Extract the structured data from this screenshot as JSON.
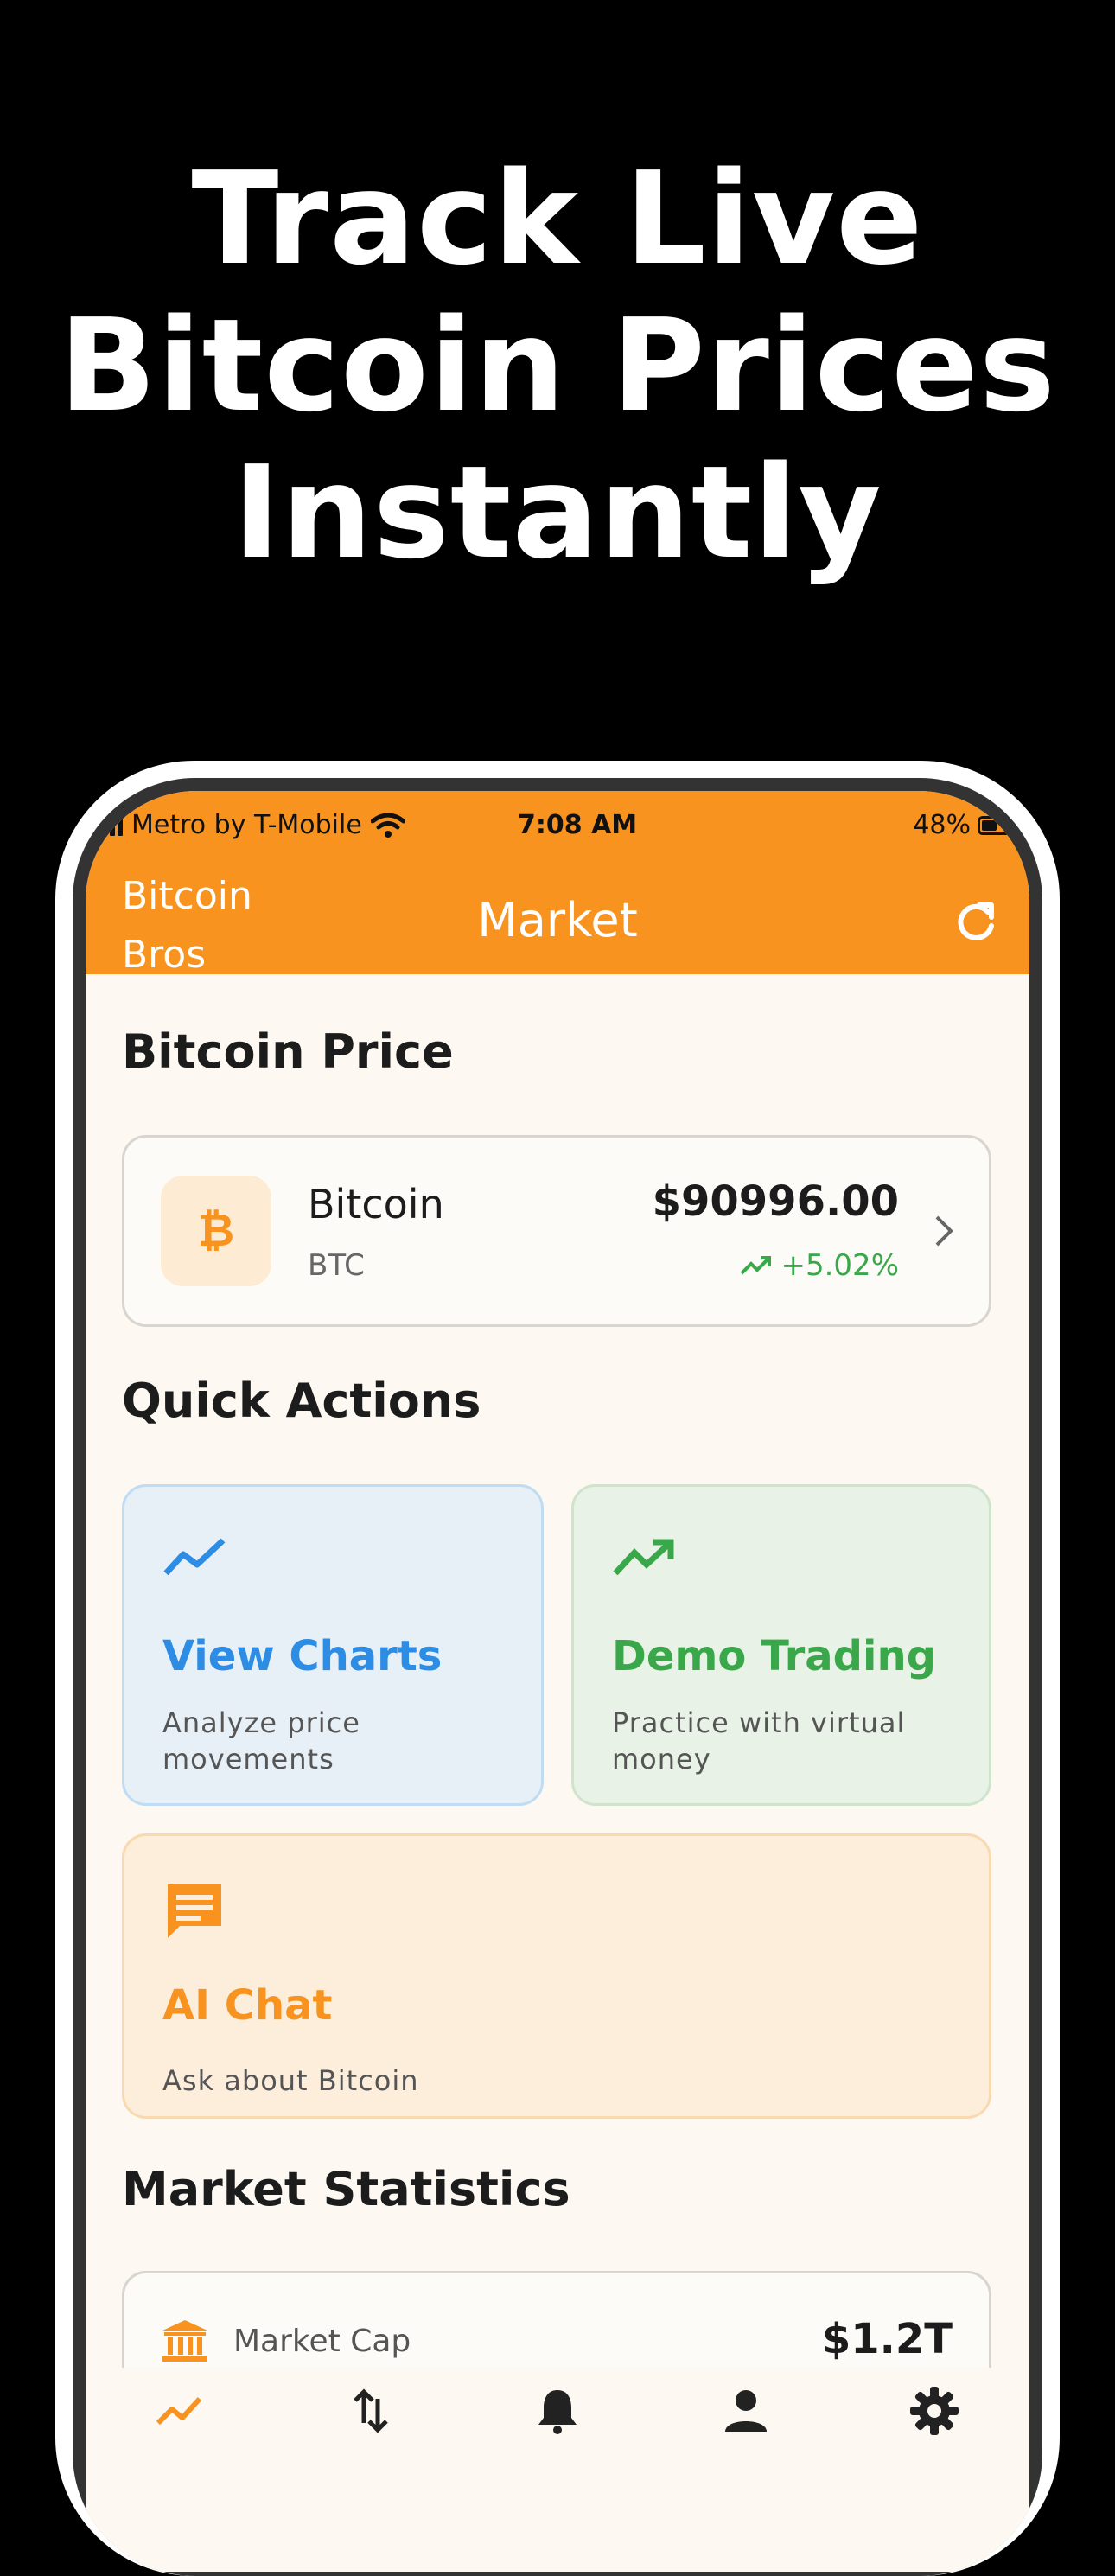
{
  "headline": {
    "line1": "Track Live",
    "line2": "Bitcoin Prices",
    "line3": "Instantly"
  },
  "status_bar": {
    "carrier": "Metro by T-Mobile",
    "time": "7:08 AM",
    "battery": "48%"
  },
  "app_bar": {
    "brand": "Bitcoin Bros",
    "title": "Market",
    "action_icon": "refresh-icon"
  },
  "sections": {
    "price": "Bitcoin Price",
    "quick_actions": "Quick Actions",
    "market_stats": "Market Statistics"
  },
  "price_card": {
    "name": "Bitcoin",
    "symbol": "BTC",
    "symbol_glyph": "₿",
    "price": "$90996.00",
    "change": "+5.02%",
    "trend_icon": "trending-up-icon"
  },
  "actions": [
    {
      "title": "View Charts",
      "subtitle": "Analyze price movements",
      "icon": "line-chart-icon",
      "color": "#2D8CE3"
    },
    {
      "title": "Demo Trading",
      "subtitle": "Practice with virtual money",
      "icon": "trending-up-icon",
      "color": "#3AA84A"
    },
    {
      "title": "AI Chat",
      "subtitle": "Ask about Bitcoin",
      "icon": "chat-icon",
      "color": "#F7931E"
    }
  ],
  "stats": [
    {
      "label": "Market Cap",
      "value": "$1.2T",
      "icon": "bank-icon"
    }
  ],
  "bottom_nav": [
    {
      "icon": "chart-icon",
      "active": true
    },
    {
      "icon": "swap-icon"
    },
    {
      "icon": "bell-icon"
    },
    {
      "icon": "person-icon"
    },
    {
      "icon": "settings-icon"
    }
  ],
  "colors": {
    "accent": "#F7931E",
    "green": "#3AA84A",
    "blue": "#2D8CE3",
    "background": "#FDF8F1"
  }
}
